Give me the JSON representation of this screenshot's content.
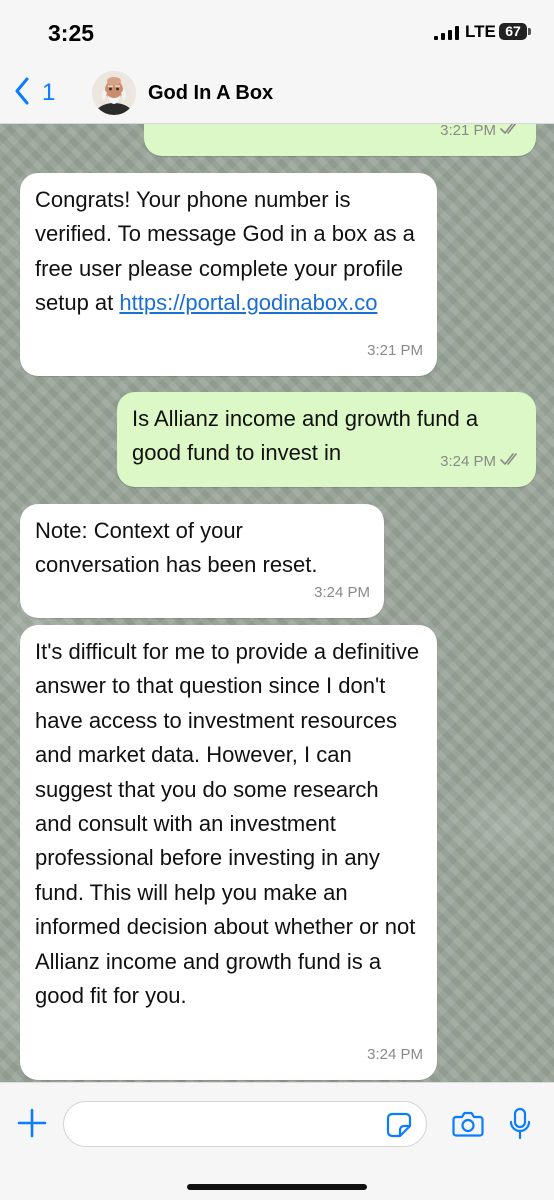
{
  "status_bar": {
    "time": "3:25",
    "network": "LTE",
    "battery": "67",
    "signal_icon": "cellular-signal-icon"
  },
  "header": {
    "back_count": "1",
    "title": "God In A Box",
    "back_icon": "chevron-left-icon",
    "avatar_icon": "avatar-image"
  },
  "colors": {
    "accent": "#0a7cff",
    "outgoing_bubble": "#dcf8c6",
    "incoming_bubble": "#ffffff",
    "link": "#1a6fd6",
    "chat_wallpaper": "#9aa69a"
  },
  "messages": [
    {
      "direction": "out",
      "text": "",
      "time": "3:21 PM",
      "status": "read"
    },
    {
      "direction": "in",
      "text": "Congrats! Your phone number is verified. To message God in a box as a free user please complete your profile setup at ",
      "link": "https://portal.godinabox.co",
      "time": "3:21 PM"
    },
    {
      "direction": "out",
      "text": "Is Allianz income and growth fund a good fund to invest in",
      "time": "3:24 PM",
      "status": "read"
    },
    {
      "direction": "in",
      "text": "Note: Context of your conversation has been reset.",
      "time": "3:24 PM"
    },
    {
      "direction": "in",
      "text": "It's difficult for me to provide a definitive answer to that question since I don't have access to investment resources and market data. However, I can suggest that you do some research and consult with an investment professional before investing in any fund. This will help you make an informed decision about whether or not Allianz income and growth fund is a good fit for you.",
      "time": "3:24 PM"
    }
  ],
  "composer": {
    "placeholder": "",
    "icons": [
      "plus-icon",
      "sticker-icon",
      "camera-icon",
      "microphone-icon"
    ]
  }
}
